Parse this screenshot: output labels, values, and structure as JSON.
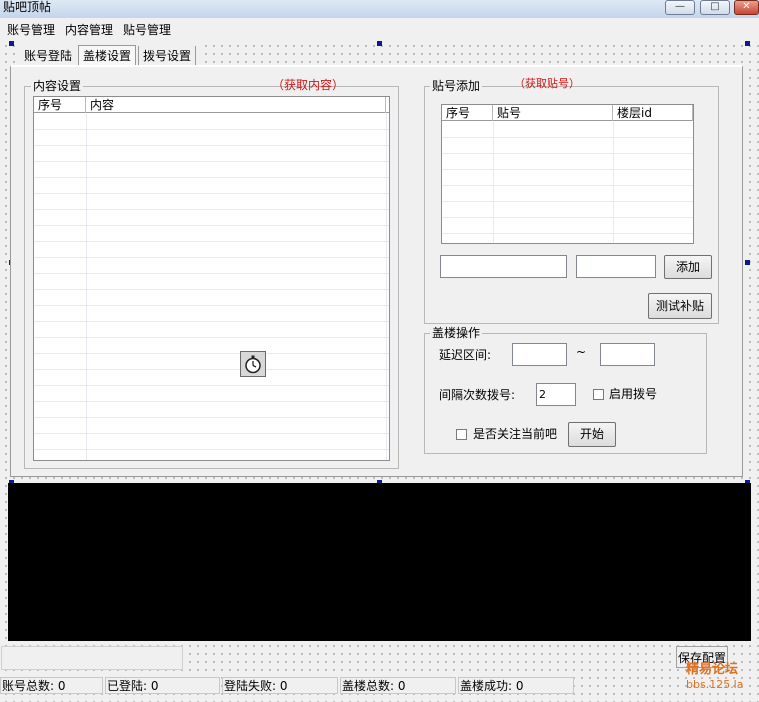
{
  "window": {
    "title": "贴吧顶帖",
    "min_glyph": "—",
    "max_glyph": "□",
    "close_glyph": "✕"
  },
  "menu": {
    "items": [
      "账号管理",
      "内容管理",
      "贴号管理"
    ]
  },
  "tabs": [
    "账号登陆",
    "盖楼设置",
    "拨号设置"
  ],
  "content_settings": {
    "title": "内容设置",
    "fetch_link": "（获取内容）",
    "columns": [
      "序号",
      "内容"
    ]
  },
  "post_add": {
    "title": "贴号添加",
    "fetch_link": "（获取贴号）",
    "columns": [
      "序号",
      "贴号",
      "楼层id"
    ],
    "add_button": "添加",
    "test_button": "测试补贴"
  },
  "build": {
    "title": "盖楼操作",
    "delay_label": "延迟区间:",
    "tilde": "~",
    "interval_label": "间隔次数拨号:",
    "interval_value": "2",
    "enable_dial_label": "启用拨号",
    "follow_label": "是否关注当前吧",
    "start_button": "开始"
  },
  "save_button": "保存配置",
  "status": [
    "账号总数: 0",
    "已登陆: 0",
    "登陆失败: 0",
    "盖楼总数: 0",
    "盖楼成功: 0"
  ],
  "watermark": {
    "line1": "精易论坛",
    "line2": "bbs.125.la"
  }
}
